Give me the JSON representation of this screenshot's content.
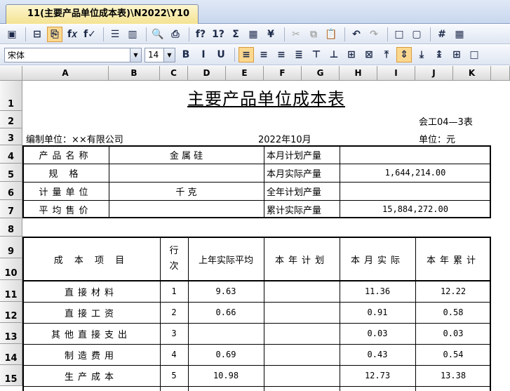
{
  "tab": {
    "title": "11(主要产品单位成本表)\\N2022\\Y10"
  },
  "toolbar1": {
    "buttons": [
      {
        "name": "save",
        "glyph": "▣"
      },
      {
        "name": "sep"
      },
      {
        "name": "preview-page",
        "glyph": "⊟"
      },
      {
        "name": "copy-format",
        "glyph": "⎘",
        "active": true
      },
      {
        "name": "fx-function",
        "glyph": "f𝑥"
      },
      {
        "name": "fx-check",
        "glyph": "f✓"
      },
      {
        "name": "sep"
      },
      {
        "name": "rows",
        "glyph": "☰"
      },
      {
        "name": "columns",
        "glyph": "▥"
      },
      {
        "name": "sep"
      },
      {
        "name": "print-preview",
        "glyph": "🔍"
      },
      {
        "name": "print",
        "glyph": "⎙"
      },
      {
        "name": "sep"
      },
      {
        "name": "formula-calc",
        "glyph": "f?"
      },
      {
        "name": "calc-191",
        "glyph": "1?"
      },
      {
        "name": "sum",
        "glyph": "Σ"
      },
      {
        "name": "calculator",
        "glyph": "▦"
      },
      {
        "name": "currency",
        "glyph": "¥"
      },
      {
        "name": "sep"
      },
      {
        "name": "cut",
        "glyph": "✂",
        "disabled": true
      },
      {
        "name": "copy",
        "glyph": "⧉",
        "disabled": true
      },
      {
        "name": "paste",
        "glyph": "📋",
        "disabled": true
      },
      {
        "name": "sep"
      },
      {
        "name": "undo",
        "glyph": "↶"
      },
      {
        "name": "redo",
        "glyph": "↷",
        "disabled": true
      },
      {
        "name": "sep"
      },
      {
        "name": "border-box",
        "glyph": "□"
      },
      {
        "name": "border-thin",
        "glyph": "▢"
      },
      {
        "name": "sep"
      },
      {
        "name": "grid-hash",
        "glyph": "#"
      },
      {
        "name": "grid-full",
        "glyph": "▦"
      }
    ]
  },
  "toolbar2": {
    "font": "宋体",
    "size": "14",
    "buttons": [
      {
        "name": "bold",
        "glyph": "B"
      },
      {
        "name": "italic",
        "glyph": "I"
      },
      {
        "name": "underline",
        "glyph": "U"
      },
      {
        "name": "sep"
      },
      {
        "name": "align-left",
        "glyph": "≡",
        "active": true
      },
      {
        "name": "align-center",
        "glyph": "≡"
      },
      {
        "name": "align-right",
        "glyph": "≡"
      },
      {
        "name": "distribute",
        "glyph": "≣"
      },
      {
        "name": "valign-1",
        "glyph": "⊤"
      },
      {
        "name": "valign-2",
        "glyph": "⊥"
      },
      {
        "name": "valign-3",
        "glyph": "⊞"
      },
      {
        "name": "valign-4",
        "glyph": "⊠"
      },
      {
        "name": "top-align",
        "glyph": "⤒"
      },
      {
        "name": "middle-align",
        "glyph": "⇕",
        "active": true
      },
      {
        "name": "bottom-align",
        "glyph": "⤓"
      },
      {
        "name": "fit-height",
        "glyph": "↨"
      },
      {
        "name": "all-borders",
        "glyph": "⊞"
      },
      {
        "name": "outer-border",
        "glyph": "□"
      }
    ]
  },
  "sheet": {
    "columns": [
      "A",
      "B",
      "C",
      "D",
      "E",
      "F",
      "G",
      "H",
      "I",
      "J",
      "K"
    ],
    "rows": [
      "1",
      "2",
      "3",
      "4",
      "5",
      "6",
      "7",
      "8",
      "9",
      "10",
      "11",
      "12",
      "13",
      "14",
      "15"
    ],
    "title": "主要产品单位成本表",
    "form_no": "会工04—3表",
    "unit_org": "编制单位：××有限公司",
    "period": "2022年10月",
    "unit": "单位：元",
    "info": [
      {
        "label": "产品名称",
        "value": "金    属    硅",
        "label2": "本月计划产量",
        "value2": ""
      },
      {
        "label": "规      格",
        "value": "",
        "label2": "本月实际产量",
        "value2": "1,644,214.00"
      },
      {
        "label": "计量单位",
        "value": "千         克",
        "label2": "全年计划产量",
        "value2": ""
      },
      {
        "label": "平均售价",
        "value": "",
        "label2": "累计实际产量",
        "value2": "15,884,272.00"
      }
    ],
    "cost_header": {
      "item": "成  本  项  目",
      "line": "行次",
      "prev_avg": "上年实际平均",
      "plan": "本年计划",
      "month_actual": "本月实际",
      "ytd": "本年累计"
    },
    "cost_rows": [
      {
        "item": "直接材料",
        "line": "1",
        "prev_avg": "9.63",
        "plan": "",
        "month_actual": "11.36",
        "ytd": "12.22"
      },
      {
        "item": "直接工资",
        "line": "2",
        "prev_avg": "0.66",
        "plan": "",
        "month_actual": "0.91",
        "ytd": "0.58"
      },
      {
        "item": "其他直接支出",
        "line": "3",
        "prev_avg": "",
        "plan": "",
        "month_actual": "0.03",
        "ytd": "0.03"
      },
      {
        "item": "制造费用",
        "line": "4",
        "prev_avg": "0.69",
        "plan": "",
        "month_actual": "0.43",
        "ytd": "0.54"
      },
      {
        "item": "生产成本",
        "line": "5",
        "prev_avg": "10.98",
        "plan": "",
        "month_actual": "12.73",
        "ytd": "13.38"
      }
    ]
  }
}
